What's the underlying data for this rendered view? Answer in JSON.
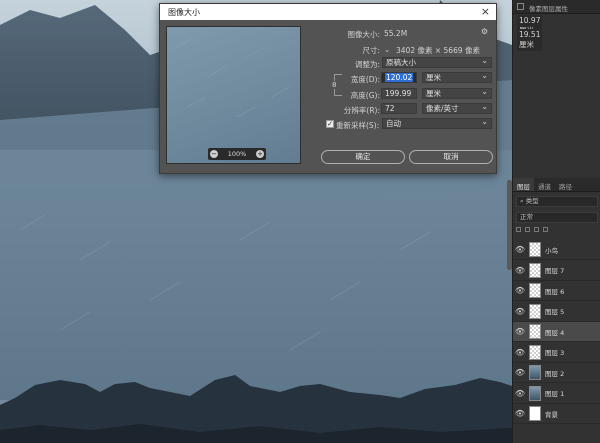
{
  "dialog": {
    "title": "图像大小",
    "close_glyph": "×",
    "image_size_label": "图像大小:",
    "image_size_value": "55.2M",
    "dimensions_label": "尺寸:",
    "dimensions_value": "3402 像素 × 5669 像素",
    "fit_to_label": "调整为:",
    "fit_to_value": "原稿大小",
    "width_label": "宽度(D):",
    "width_value": "120.02",
    "width_unit": "厘米",
    "height_label": "高度(G):",
    "height_value": "199.99",
    "height_unit": "厘米",
    "resolution_label": "分辨率(R):",
    "resolution_value": "72",
    "resolution_unit": "像素/英寸",
    "resample_label": "重新采样(S):",
    "resample_checked": true,
    "resample_value": "自动",
    "ok_label": "确定",
    "cancel_label": "取消",
    "preview_zoom": "100%",
    "link_glyph": "8",
    "gear_icon": "gear-icon"
  },
  "properties_panel": {
    "header": "像素图层属性",
    "w_value": "10.97 厘米",
    "h_value": "19.51 厘米"
  },
  "layers_panel": {
    "tabs": [
      "图层",
      "通道",
      "路径"
    ],
    "active_tab": 0,
    "filter_placeholder": "类型",
    "blend_mode": "正常",
    "layers": [
      {
        "name": "小鸟",
        "thumb": "checker",
        "visible": true,
        "selected": false
      },
      {
        "name": "图层 7",
        "thumb": "checker",
        "visible": true,
        "selected": false
      },
      {
        "name": "图层 6",
        "thumb": "checker",
        "visible": true,
        "selected": false
      },
      {
        "name": "图层 5",
        "thumb": "checker",
        "visible": true,
        "selected": false
      },
      {
        "name": "图层 4",
        "thumb": "checker",
        "visible": true,
        "selected": true
      },
      {
        "name": "图层 3",
        "thumb": "checker",
        "visible": true,
        "selected": false
      },
      {
        "name": "图层 2",
        "thumb": "img",
        "visible": true,
        "selected": false
      },
      {
        "name": "图层 1",
        "thumb": "img",
        "visible": true,
        "selected": false
      },
      {
        "name": "背景",
        "thumb": "white",
        "visible": true,
        "selected": false
      }
    ]
  },
  "colors": {
    "canvas_sky": "#7f99ad",
    "mountain_dark": "#44525f",
    "foreground": "#26323d",
    "highlight": "#2f6fd5"
  }
}
